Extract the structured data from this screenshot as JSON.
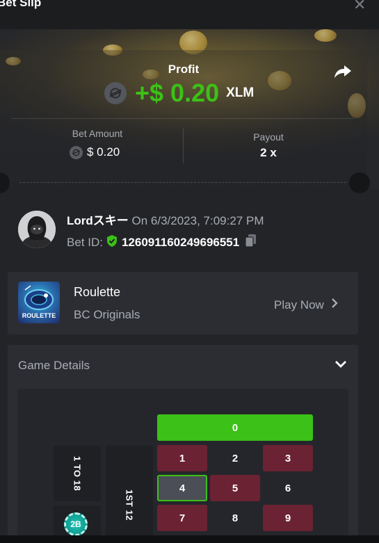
{
  "header": {
    "title": "Bet Slip"
  },
  "profit": {
    "label": "Profit",
    "amount": "+$ 0.20",
    "currency": "XLM"
  },
  "bet_amount": {
    "label": "Bet Amount",
    "value": "$ 0.20"
  },
  "payout": {
    "label": "Payout",
    "value": "2 x"
  },
  "user": {
    "name": "Lordスキー",
    "date": "On 6/3/2023, 7:09:27 PM",
    "bet_id_label": "Bet ID:",
    "bet_id": "126091160249696551"
  },
  "game": {
    "thumb_label": "ROULETTE",
    "name": "Roulette",
    "provider": "BC Originals",
    "play_label": "Play Now"
  },
  "details": {
    "title": "Game Details"
  },
  "board": {
    "zero": "0",
    "side_1": "1 TO 18",
    "side_2": "1ST 12",
    "chip": "2B",
    "numbers": [
      "1",
      "2",
      "3",
      "4",
      "5",
      "6",
      "7",
      "8",
      "9"
    ]
  },
  "colors": {
    "accent_green": "#3bc117",
    "red_cell": "#6b2232"
  }
}
